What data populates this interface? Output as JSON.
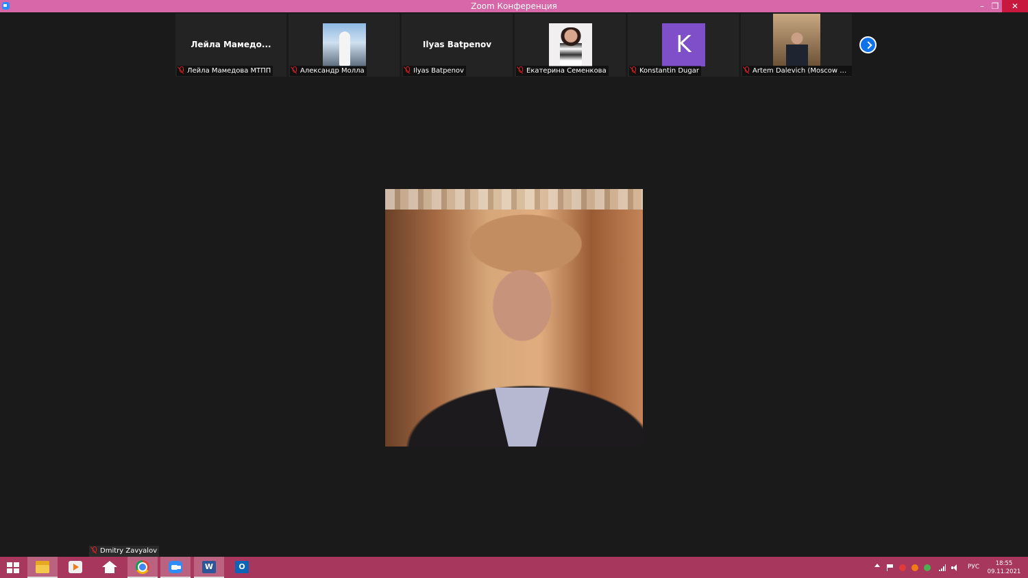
{
  "window": {
    "title": "Zoom Конференция",
    "controls": {
      "minimize": "–",
      "maximize": "❐",
      "close": "✕"
    }
  },
  "gallery": {
    "tiles": [
      {
        "display_name": "Лейла  Мамедо...",
        "label": "Лейла Мамедова МТПП",
        "muted": true,
        "video": "name-only"
      },
      {
        "display_name": "",
        "label": "Александр Молла",
        "muted": true,
        "video": "profile-photo"
      },
      {
        "display_name": "Ilyas Batpenov",
        "label": "Ilyas Batpenov",
        "muted": true,
        "video": "name-only"
      },
      {
        "display_name": "",
        "label": "Екатерина Семенкова",
        "muted": true,
        "video": "profile-photo"
      },
      {
        "display_name": "",
        "avatar_letter": "K",
        "avatar_color": "#7f4fc9",
        "label": "Konstantin Dugar",
        "muted": true,
        "video": "avatar"
      },
      {
        "display_name": "",
        "label": "Artem Dalevich (Moscow Cha...",
        "muted": true,
        "video": "camera"
      }
    ],
    "next_page_icon": "chevron-right-icon"
  },
  "main": {
    "speaker_label": "Dmitry Zavyalov",
    "speaker_muted": true
  },
  "taskbar": {
    "apps": [
      "start",
      "file-explorer",
      "media-player",
      "home",
      "chrome",
      "zoom",
      "word",
      "outlook"
    ],
    "active_app": "zoom",
    "word_glyph": "W",
    "outlook_glyph": "O",
    "language": "РУС",
    "time": "18:55",
    "date": "09.11.2021"
  },
  "colors": {
    "titlebar": "#d767a8",
    "taskbar": "#a8375e",
    "background": "#1a1a1a",
    "accent": "#0e72ed"
  }
}
